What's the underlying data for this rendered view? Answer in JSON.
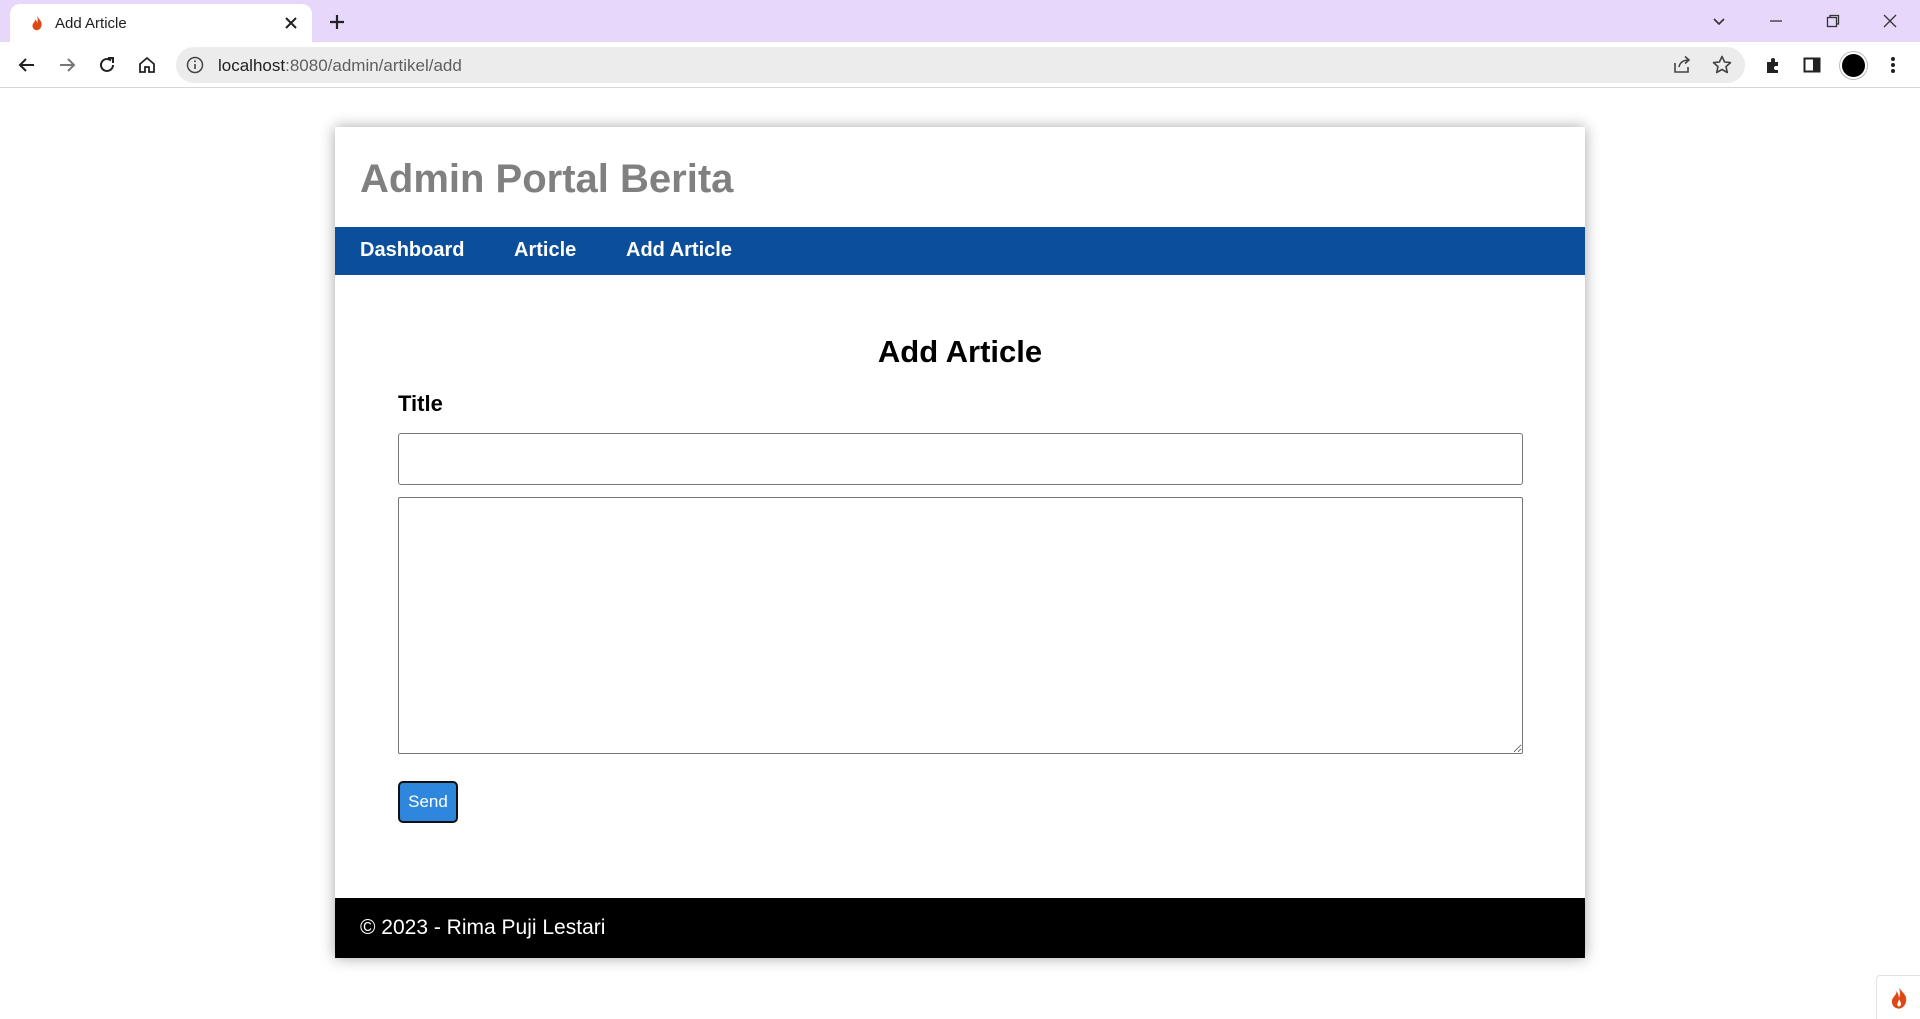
{
  "browser": {
    "tab": {
      "title": "Add Article",
      "favicon": "codeigniter-flame-icon"
    },
    "address": {
      "host": "localhost",
      "path": ":8080/admin/artikel/add"
    },
    "colors": {
      "tabbar": "#e6d7fb",
      "omnibox": "#ececec"
    }
  },
  "site": {
    "title": "Admin Portal Berita",
    "nav": [
      {
        "label": "Dashboard"
      },
      {
        "label": "Article"
      },
      {
        "label": "Add Article"
      }
    ],
    "colors": {
      "nav": "#0b4f9c",
      "title": "#808080",
      "footer": "#000000"
    }
  },
  "form": {
    "heading": "Add Article",
    "title_label": "Title",
    "title_value": "",
    "content_value": "",
    "submit_label": "Send",
    "submit_color": "#2f86dd"
  },
  "footer": {
    "text": "© 2023 - Rima Puji Lestari"
  }
}
